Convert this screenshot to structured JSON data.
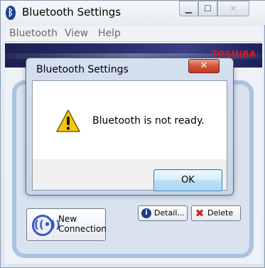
{
  "main_window": {
    "title": "Bluetooth Settings",
    "menu": [
      "Bluetooth",
      "View",
      "Help"
    ],
    "brand": "TOSHIBA",
    "new_connection_label": "New Connection",
    "detail_label": "Detail...",
    "delete_label": "Delete"
  },
  "dialog": {
    "title": "Bluetooth Settings",
    "message": "Bluetooth is not ready.",
    "ok_label": "OK"
  },
  "icons": {
    "app": "bluetooth-icon",
    "warning": "warning-icon",
    "close": "close-icon",
    "new_connection": "wireless-icon",
    "detail": "info-icon",
    "delete": "delete-icon"
  },
  "colors": {
    "dialog_close": "#c1391f",
    "ok_button_border": "#3c7fb1",
    "warning_fill": "#f5c518",
    "brand_red": "#e01a1a"
  }
}
